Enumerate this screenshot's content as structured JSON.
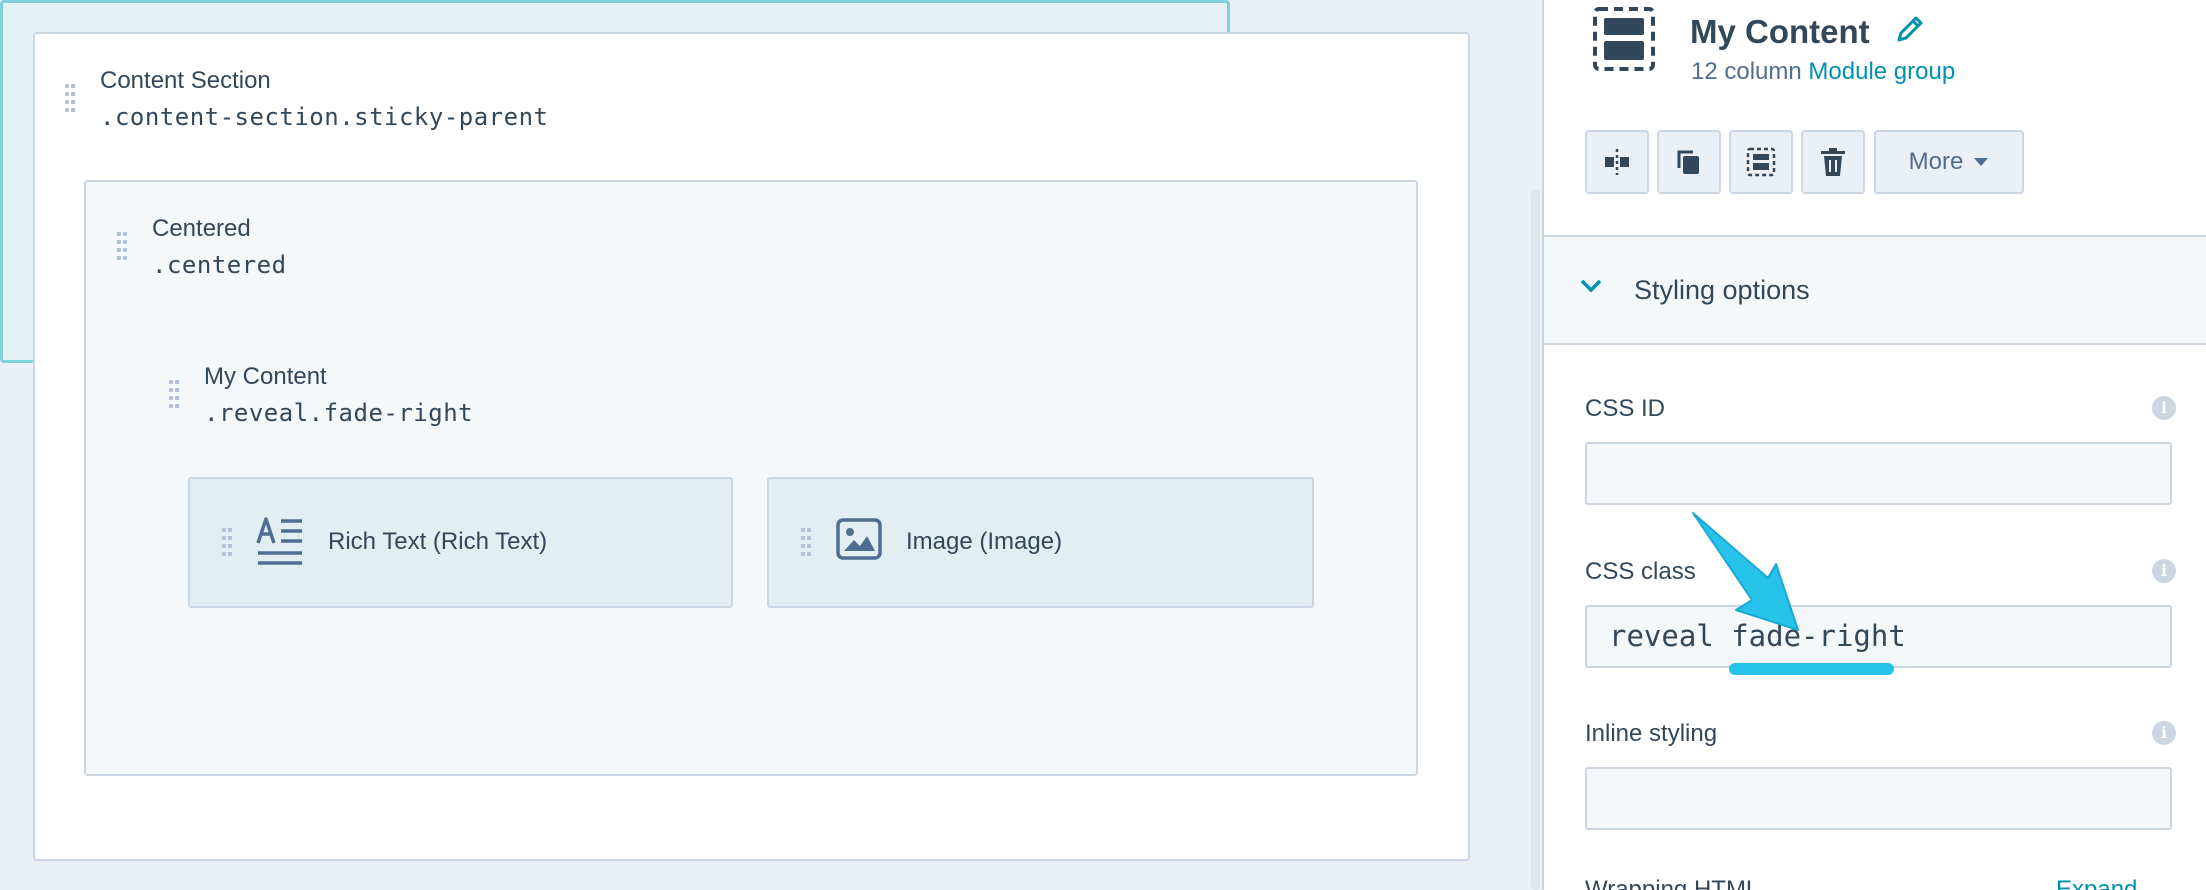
{
  "canvas": {
    "section": {
      "title": "Content Section",
      "css_class": ".content-section.sticky-parent"
    },
    "centered": {
      "title": "Centered",
      "css_class": ".centered"
    },
    "my_content": {
      "title": "My Content",
      "css_class": ".reveal.fade-right"
    },
    "modules": [
      {
        "label": "Rich Text (Rich Text)",
        "icon": "rich-text-icon"
      },
      {
        "label": "Image (Image)",
        "icon": "image-icon"
      }
    ]
  },
  "panel": {
    "title": "My Content",
    "subtitle_prefix": "12 column",
    "subtitle_link": "Module group",
    "toolbar": {
      "more_label": "More"
    },
    "styling_section": "Styling options",
    "fields": {
      "css_id": {
        "label": "CSS ID",
        "value": ""
      },
      "css_class": {
        "label": "CSS class",
        "value": "reveal fade-right"
      },
      "inline_styling": {
        "label": "Inline styling",
        "value": ""
      }
    },
    "wrap_label": "Wrapping HTML",
    "wrap_link": "Expand"
  },
  "colors": {
    "accent": "#0091ae",
    "highlight_border": "#7fd1de",
    "highlight_bg": "#e5f1f5",
    "annotation": "#27c2ea",
    "text": "#33475b"
  }
}
